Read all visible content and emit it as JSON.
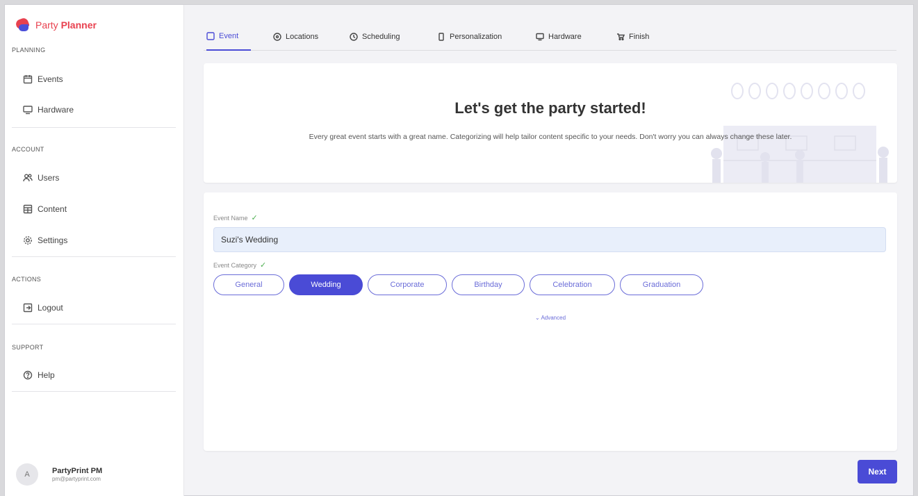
{
  "app": {
    "logo_part1": "Party",
    "logo_part2": "Planner"
  },
  "colors": {
    "accent": "#4a4bd6",
    "brand_red": "#e8414f",
    "check_green": "#4caf50",
    "input_bg": "#e8effb"
  },
  "sidebar": {
    "sections": [
      {
        "label": "PLANNING",
        "items": [
          {
            "label": "Events",
            "icon": "calendar-icon"
          },
          {
            "label": "Hardware",
            "icon": "monitor-icon"
          }
        ]
      },
      {
        "label": "ACCOUNT",
        "items": [
          {
            "label": "Users",
            "icon": "users-icon"
          },
          {
            "label": "Content",
            "icon": "content-icon"
          },
          {
            "label": "Settings",
            "icon": "gear-icon"
          }
        ]
      },
      {
        "label": "ACTIONS",
        "items": [
          {
            "label": "Logout",
            "icon": "logout-icon"
          }
        ]
      },
      {
        "label": "SUPPORT",
        "items": [
          {
            "label": "Help",
            "icon": "help-icon"
          }
        ]
      }
    ],
    "profile": {
      "initial": "A",
      "name": "PartyPrint PM",
      "email": "pm@partyprint.com"
    }
  },
  "tabs": [
    {
      "label": "Event",
      "icon": "square-icon",
      "active": true
    },
    {
      "label": "Locations",
      "icon": "pin-icon",
      "active": false
    },
    {
      "label": "Scheduling",
      "icon": "clock-icon",
      "active": false
    },
    {
      "label": "Personalization",
      "icon": "phone-icon",
      "active": false
    },
    {
      "label": "Hardware",
      "icon": "monitor-icon",
      "active": false
    },
    {
      "label": "Finish",
      "icon": "cart-icon",
      "active": false
    }
  ],
  "hero": {
    "title": "Let's get the party started!",
    "subtitle": "Every great event starts with a great name. Categorizing will help tailor content specific to your needs. Don't worry you can always change these later."
  },
  "form": {
    "event_name_label": "Event Name",
    "event_name_value": "Suzi's Wedding",
    "event_category_label": "Event Category",
    "categories": [
      {
        "label": "General",
        "selected": false
      },
      {
        "label": "Wedding",
        "selected": true
      },
      {
        "label": "Corporate",
        "selected": false
      },
      {
        "label": "Birthday",
        "selected": false
      },
      {
        "label": "Celebration",
        "selected": false
      },
      {
        "label": "Graduation",
        "selected": false
      }
    ],
    "advanced_label": "Advanced"
  },
  "actions": {
    "next_label": "Next"
  }
}
